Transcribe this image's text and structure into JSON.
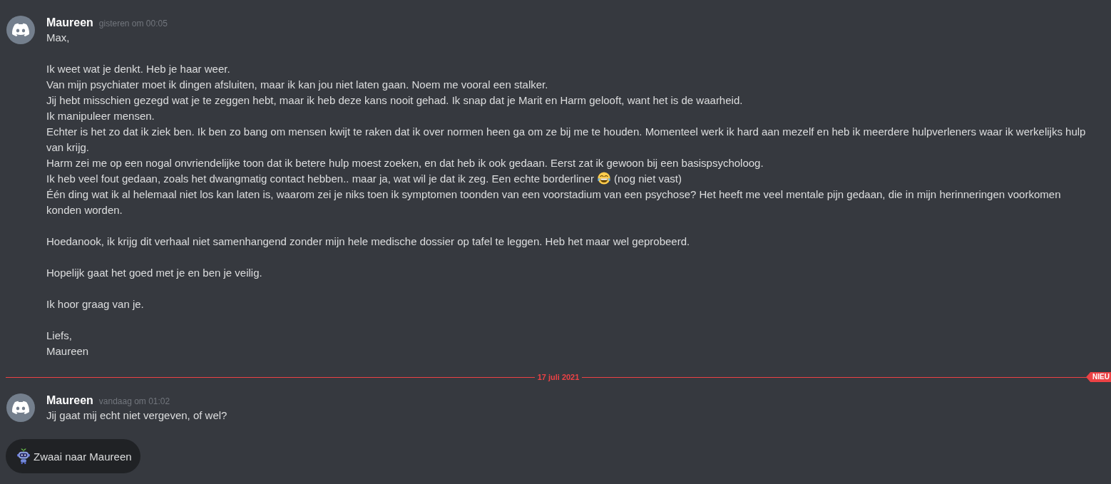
{
  "feed": [
    {
      "kind": "message",
      "author": "Maureen",
      "timestamp": "gisteren om 00:05",
      "paragraphs": [
        [
          {
            "kind": "text",
            "text": "Max,"
          }
        ],
        [
          {
            "kind": "text",
            "text": "Ik weet wat je denkt. Heb je haar weer."
          },
          {
            "kind": "text",
            "text": "Van mijn psychiater moet ik dingen afsluiten, maar ik kan jou niet laten gaan. Noem me vooral een stalker."
          },
          {
            "kind": "text",
            "text": "Jij hebt misschien gezegd wat je te zeggen hebt, maar ik heb deze kans nooit gehad. Ik snap dat je Marit en Harm gelooft, want het is de waarheid."
          },
          {
            "kind": "text",
            "text": "Ik manipuleer mensen."
          },
          {
            "kind": "text",
            "text": "Echter is het zo dat ik ziek ben. Ik ben zo bang om mensen kwijt te raken dat ik over normen heen ga om ze bij me te houden. Momenteel werk ik hard aan mezelf en heb ik meerdere hulpverleners waar ik werkelijks hulp van krijg."
          },
          {
            "kind": "text",
            "text": "Harm zei me op een nogal onvriendelijke toon dat ik betere hulp moest zoeken, en dat heb ik ook gedaan. Eerst zat ik gewoon bij een basispsycholoog."
          },
          {
            "kind": "emoji",
            "text": "Ik heb veel fout gedaan, zoals het dwangmatig contact hebben.. maar ja, wat wil je dat ik zeg. Een echte borderliner",
            "after": "(nog niet vast)"
          },
          {
            "kind": "text",
            "text": "Één ding wat ik al helemaal niet los kan laten is, waarom zei je niks toen ik symptomen toonden van een voorstadium van een psychose? Het heeft me veel mentale pijn gedaan, die in mijn herinneringen voorkomen konden worden."
          }
        ],
        [
          {
            "kind": "text",
            "text": "Hoedanook, ik krijg dit verhaal niet samenhangend zonder mijn hele medische dossier op tafel te leggen. Heb het maar wel geprobeerd."
          }
        ],
        [
          {
            "kind": "text",
            "text": "Hopelijk gaat het goed met je en ben je veilig."
          }
        ],
        [
          {
            "kind": "text",
            "text": "Ik hoor graag van je."
          }
        ],
        [
          {
            "kind": "text",
            "text": "Liefs,"
          },
          {
            "kind": "text",
            "text": "Maureen"
          }
        ]
      ]
    },
    {
      "kind": "divider",
      "date": "17 juli 2021",
      "badge": "NIEU"
    },
    {
      "kind": "message",
      "author": "Maureen",
      "timestamp": "vandaag om 01:02",
      "paragraphs": [
        [
          {
            "kind": "text",
            "text": "Jij gaat mij echt niet vergeven, of wel?"
          }
        ]
      ]
    }
  ],
  "wave_button": {
    "label": "Zwaai naar Maureen"
  }
}
